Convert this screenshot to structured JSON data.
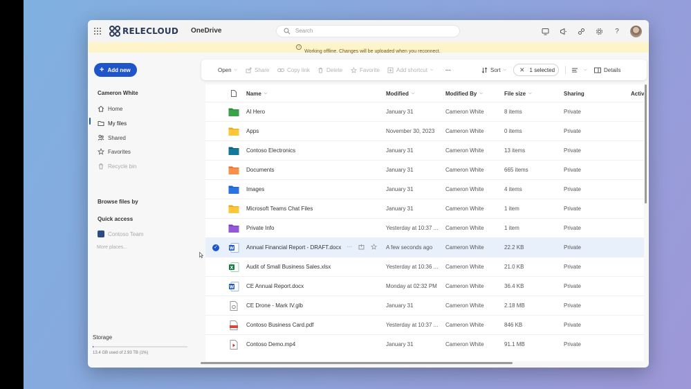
{
  "header": {
    "brand": "RELECLOUD",
    "app_name": "OneDrive",
    "search_placeholder": "Search"
  },
  "banner": {
    "text": "Working offline. Changes will be uploaded when you reconnect."
  },
  "sidebar": {
    "add_new_label": "Add new",
    "user_name": "Cameron White",
    "nav": [
      {
        "label": "Home",
        "icon": "home-icon",
        "state": "normal"
      },
      {
        "label": "My files",
        "icon": "folder-icon",
        "state": "active"
      },
      {
        "label": "Shared",
        "icon": "people-icon",
        "state": "normal"
      },
      {
        "label": "Favorites",
        "icon": "star-icon",
        "state": "normal"
      },
      {
        "label": "Recycle bin",
        "icon": "trash-icon",
        "state": "disabled"
      }
    ],
    "browse_files_by": "Browse files by",
    "quick_access": "Quick access",
    "quick_access_items": [
      {
        "label": "Contoso Team"
      }
    ],
    "more_places": "More places...",
    "storage": {
      "heading": "Storage",
      "text": "13.4 GB used of 2.93 TB (1%)",
      "used_fraction": 0.01
    }
  },
  "toolbar": {
    "open": "Open",
    "share": "Share",
    "copy_link": "Copy link",
    "delete": "Delete",
    "favorite": "Favorite",
    "add_shortcut": "Add shortcut",
    "more": "···",
    "sort": "Sort",
    "selected": "1 selected",
    "details": "Details"
  },
  "table": {
    "columns": {
      "name": "Name",
      "modified": "Modified",
      "modified_by": "Modified By",
      "file_size": "File size",
      "sharing": "Sharing",
      "activity": "Activ"
    },
    "rows": [
      {
        "icon": "folder-green",
        "name": "AI Hero",
        "modified": "January 31",
        "modified_by": "Cameron White",
        "size": "8 items",
        "sharing": "Private"
      },
      {
        "icon": "folder-yellow",
        "name": "Apps",
        "modified": "November 30, 2023",
        "modified_by": "Cameron White",
        "size": "0 items",
        "sharing": "Private"
      },
      {
        "icon": "folder-teal",
        "name": "Contoso Electronics",
        "modified": "January 31",
        "modified_by": "Cameron White",
        "size": "13 items",
        "sharing": "Private"
      },
      {
        "icon": "folder-orange",
        "name": "Documents",
        "modified": "January 31",
        "modified_by": "Cameron White",
        "size": "665 items",
        "sharing": "Private"
      },
      {
        "icon": "folder-blue",
        "name": "Images",
        "modified": "January 31",
        "modified_by": "Cameron White",
        "size": "4 items",
        "sharing": "Private"
      },
      {
        "icon": "folder-yellow",
        "name": "Microsoft Teams Chat Files",
        "modified": "January 31",
        "modified_by": "Cameron White",
        "size": "1 item",
        "sharing": "Private"
      },
      {
        "icon": "folder-purple",
        "name": "Private Info",
        "modified": "Yesterday at 10:37 ...",
        "modified_by": "Cameron White",
        "size": "1 item",
        "sharing": "Private"
      },
      {
        "icon": "word",
        "name": "Annual Financial Report - DRAFT.docx",
        "modified": "A few seconds ago",
        "modified_by": "Cameron White",
        "size": "22.2 KB",
        "sharing": "Private",
        "selected": true
      },
      {
        "icon": "excel",
        "name": "Audit of Small Business Sales.xlsx",
        "modified": "Yesterday at 10:36 ...",
        "modified_by": "Cameron White",
        "size": "21.0 KB",
        "sharing": "Private"
      },
      {
        "icon": "word",
        "name": "CE Annual Report.docx",
        "modified": "Monday at 02:32 PM",
        "modified_by": "Cameron White",
        "size": "36.4 KB",
        "sharing": "Private"
      },
      {
        "icon": "glb",
        "name": "CE Drone - Mark IV.glb",
        "modified": "January 31",
        "modified_by": "Cameron White",
        "size": "2.18 MB",
        "sharing": "Private"
      },
      {
        "icon": "pdf",
        "name": "Contoso Business Card.pdf",
        "modified": "Yesterday at 10:37 ...",
        "modified_by": "Cameron White",
        "size": "846 KB",
        "sharing": "Private"
      },
      {
        "icon": "video",
        "name": "Contoso Demo.mp4",
        "modified": "January 31",
        "modified_by": "Cameron White",
        "size": "91.1 MB",
        "sharing": "Private"
      }
    ]
  },
  "colors": {
    "accent": "#1f55c8",
    "banner_bg": "#fdf4c9",
    "selected_row": "#e8f1fb"
  }
}
